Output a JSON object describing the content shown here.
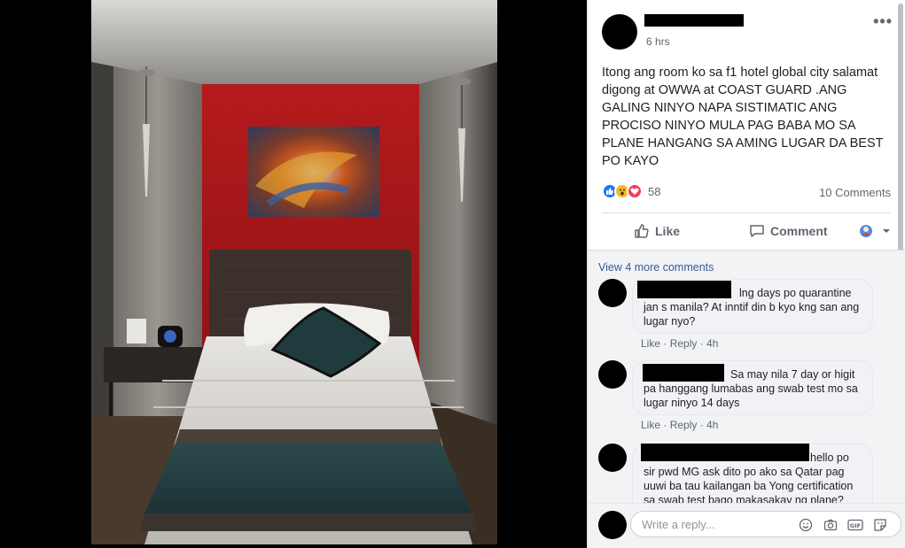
{
  "post": {
    "time": "6 hrs",
    "text": "Itong ang room ko sa f1 hotel global city salamat digong at OWWA at COAST GUARD .ANG GALING NINYO NAPA SISTIMATIC ANG PROCISO NINYO MULA PAG BABA MO SA PLANE HANGANG SA AMING LUGAR DA BEST PO KAYO",
    "reaction_count": "58",
    "comment_count": "10 Comments"
  },
  "actions": {
    "like": "Like",
    "comment": "Comment"
  },
  "comments": {
    "view_more": "View 4 more comments",
    "items": [
      {
        "text": "lng days po quarantine jan s manila? At inntif din b kyo kng san ang lugar nyo?",
        "like": "Like",
        "reply": "Reply",
        "time": "4h"
      },
      {
        "text": "Sa may nila 7 day or higit pa hanggang lumabas ang swab test mo sa lugar ninyo 14 days",
        "like": "Like",
        "reply": "Reply",
        "time": "4h"
      },
      {
        "text": "hello po sir pwd MG ask dito po ako sa Qatar pag uuwi ba tau kailangan ba Yong certification sa swab test bago makasakay ng plane?"
      }
    ]
  },
  "reply": {
    "placeholder": "Write a reply..."
  },
  "icons": {
    "more": "more-options-icon",
    "like": "thumbs-up-icon",
    "comment": "speech-bubble-icon",
    "emoji": "emoji-icon",
    "camera": "camera-icon",
    "gif": "gif-icon",
    "sticker": "sticker-icon"
  },
  "colors": {
    "link": "#385898",
    "like_blue": "#1877f2",
    "wall_red": "#b0171a"
  }
}
